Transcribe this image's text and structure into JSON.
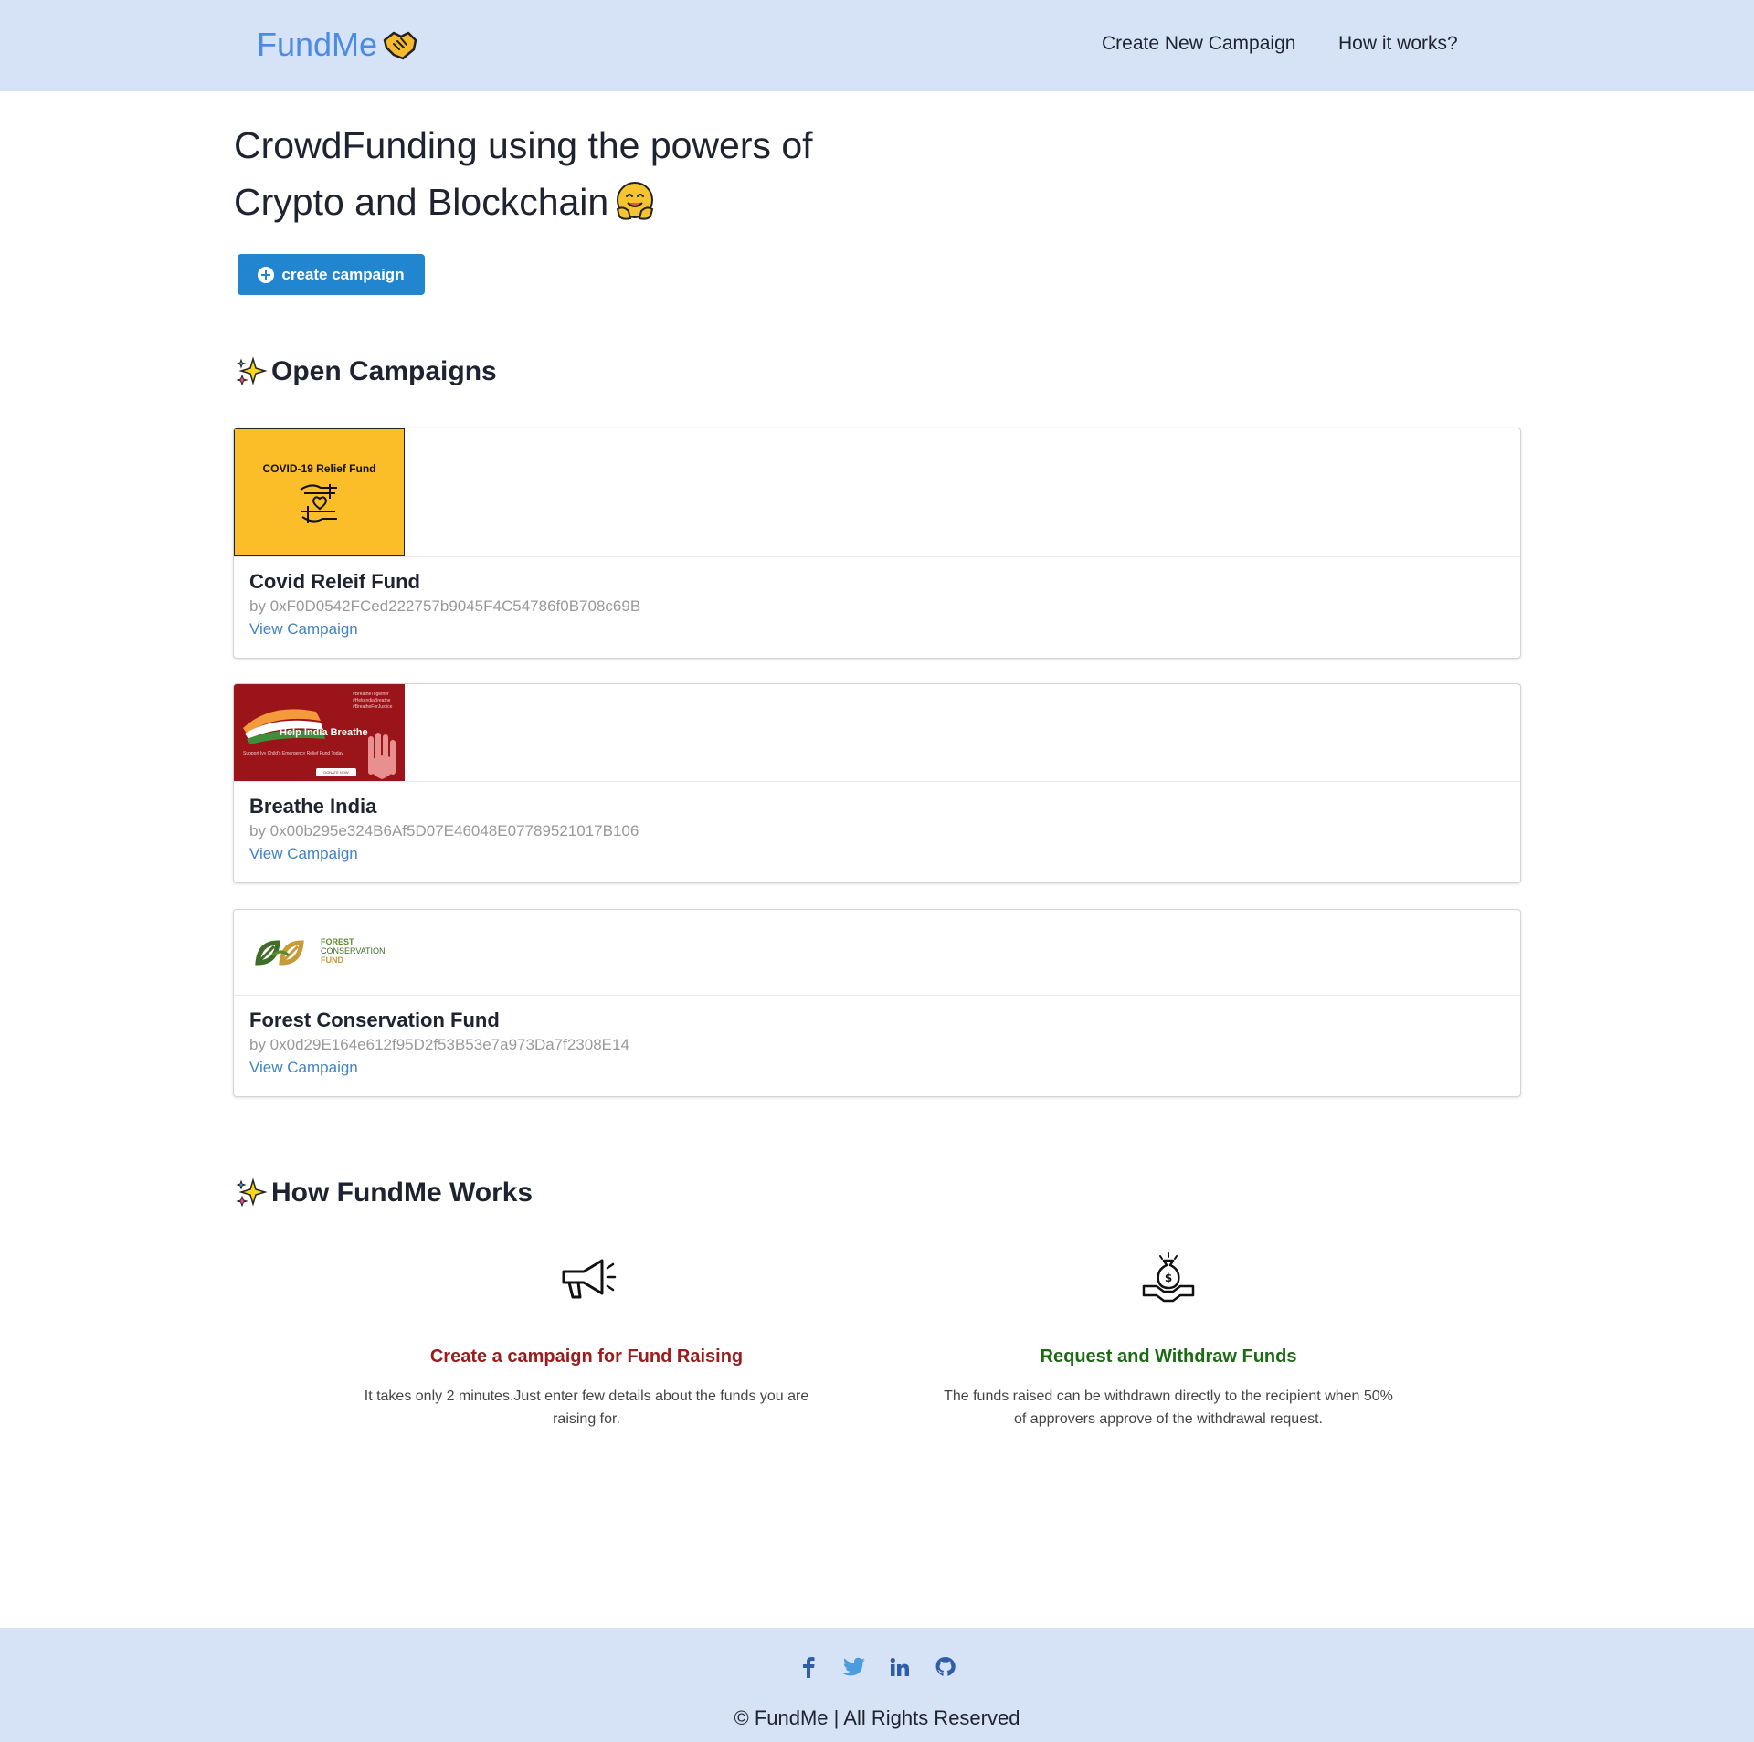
{
  "header": {
    "brand": "FundMe",
    "nav": {
      "create": "Create New Campaign",
      "how": "How it works?"
    }
  },
  "hero": {
    "title_line1": "CrowdFunding using the powers of",
    "title_line2": "Crypto and Blockchain",
    "button_label": "create campaign"
  },
  "open_campaigns": {
    "heading": "Open Campaigns",
    "items": [
      {
        "title": "Covid Releif Fund",
        "owner": "by 0xF0D0542FCed222757b9045F4C54786f0B708c69B",
        "link": "View Campaign",
        "image_text": "COVID-19 Relief Fund"
      },
      {
        "title": "Breathe India",
        "owner": "by 0x00b295e324B6Af5D07E46048E07789521017B106",
        "link": "View Campaign",
        "image_text": "Help India Breathe",
        "image_tags": "#BreatheTogether\n#HelpIndiaBreathe\n#BreatheForJustice",
        "image_small": "Support Ivy Child's Emergency Relief Fund Today",
        "image_button": "DONATE NOW"
      },
      {
        "title": "Forest Conservation Fund",
        "owner": "by 0x0d29E164e612f95D2f53B53e7a973Da7f2308E14",
        "link": "View Campaign",
        "image_line1": "FOREST",
        "image_line2": "CONSERVATION",
        "image_line3": "FUND"
      }
    ]
  },
  "how_it_works": {
    "heading": "How FundMe Works",
    "steps": [
      {
        "icon": "megaphone-icon",
        "title": "Create a campaign for Fund Raising",
        "description": "It takes only 2 minutes.Just enter few details about the funds you are raising for."
      },
      {
        "icon": "money-bag-icon",
        "title": "Request and Withdraw Funds",
        "description": "The funds raised can be withdrawn directly to the recipient when 50% of approvers approve of the withdrawal request."
      }
    ]
  },
  "footer": {
    "social": [
      "facebook-icon",
      "twitter-icon",
      "linkedin-icon",
      "github-icon"
    ],
    "copyright": "© FundMe | All Rights Reserved"
  },
  "colors": {
    "header_bg": "#d6e2f5",
    "brand": "#4a8be8",
    "primary_button": "#2185d0",
    "link": "#4183c4",
    "step1_title": "#9b1c1c",
    "step2_title": "#1b6b12"
  }
}
